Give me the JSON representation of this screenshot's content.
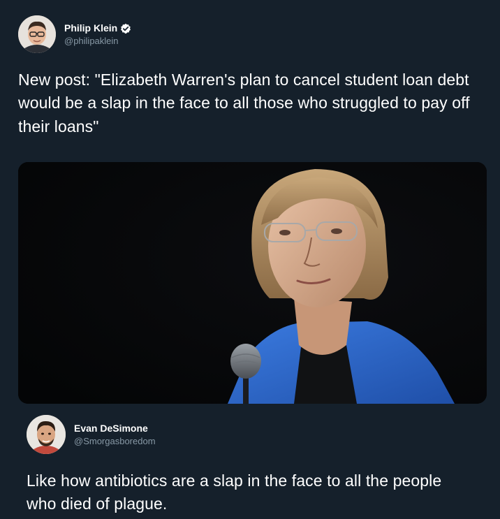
{
  "tweet": {
    "author": {
      "name": "Philip Klein",
      "handle": "@philipaklein",
      "verified": true
    },
    "text": "New post: \"Elizabeth Warren's plan to cancel student loan debt would be a slap in the face to all those who struggled to pay off their loans\"",
    "media": {
      "type": "photo"
    }
  },
  "reply": {
    "author": {
      "name": "Evan DeSimone",
      "handle": "@Smorgasboredom"
    },
    "text": "Like how antibiotics are a slap in the face to all the people who died of plague."
  },
  "colors": {
    "background": "#15202b",
    "text": "#ffffff",
    "secondary_text": "#8899a6",
    "verified_badge": "#ffffff",
    "blazer_blue": "#2f6fd6"
  },
  "icons": {
    "verified": "verified-check-icon"
  }
}
